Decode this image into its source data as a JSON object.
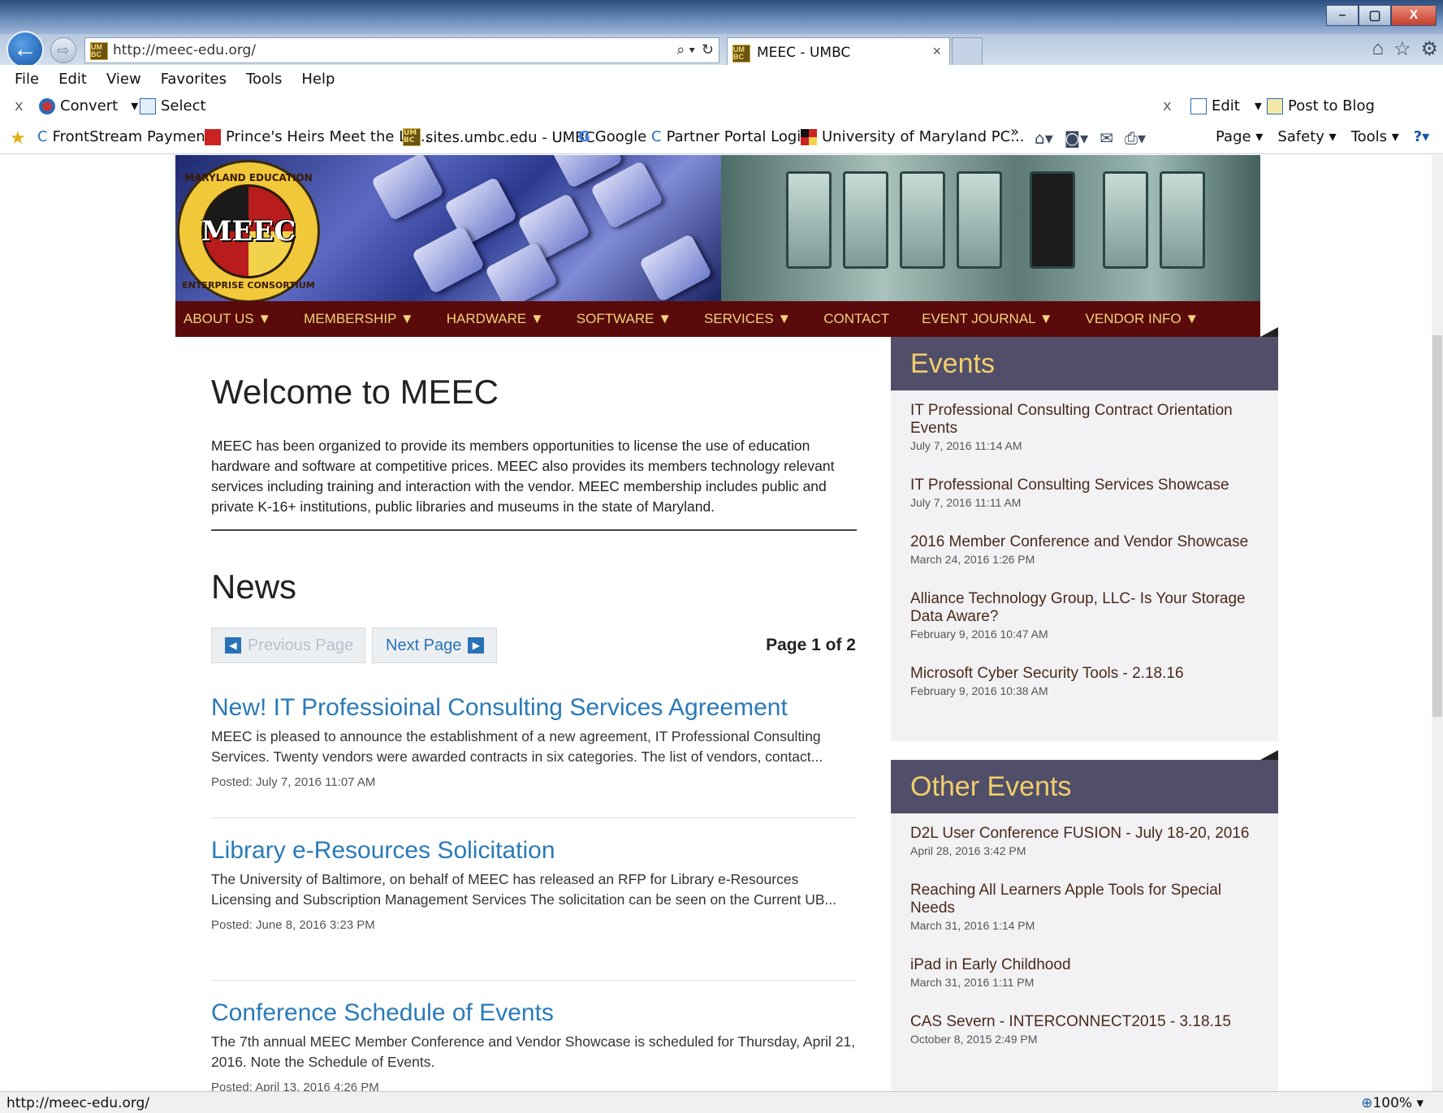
{
  "window": {
    "min": "–",
    "max": "▢",
    "close": "X"
  },
  "nav": {
    "address": "http://meec-edu.org/",
    "address_tools": [
      "⌕ ▾",
      "↻"
    ],
    "tab_title": "MEEC - UMBC",
    "tab_close": "×",
    "right_icons": [
      "⌂",
      "☆",
      "⚙"
    ]
  },
  "favicon": "UM BC",
  "menubar": [
    "File",
    "Edit",
    "View",
    "Favorites",
    "Tools",
    "Help"
  ],
  "cmdbar": {
    "close": "x",
    "convert": "Convert",
    "select": "Select",
    "close2": "x",
    "edit": "Edit",
    "post_to_blog": "Post to Blog",
    "dropdown": "▾"
  },
  "favbar": {
    "items": [
      "FrontStream Payments",
      "Prince's Heirs Meet the La...",
      "sites.umbc.edu - UMBC",
      "Google",
      "Partner Portal Login",
      "University of Maryland PC..."
    ],
    "more": "»",
    "tools": [
      "Page ▾",
      "Safety ▾",
      "Tools ▾"
    ]
  },
  "site": {
    "logo_text": "MEEC",
    "logo_ring_top": "MARYLAND EDUCATION",
    "logo_ring_bottom": "ENTERPRISE CONSORTIUM",
    "nav": [
      "ABOUT US ▼",
      "MEMBERSHIP ▼",
      "HARDWARE ▼",
      "SOFTWARE ▼",
      "SERVICES ▼",
      "CONTACT",
      "EVENT JOURNAL ▼",
      "VENDOR INFO ▼"
    ],
    "welcome": "Welcome to MEEC",
    "intro": "MEEC has been organized to provide its members opportunities to license the use of education hardware and software at competitive prices. MEEC also provides its members technology relevant services including training and interaction with the vendor. MEEC membership includes public and private K-16+ institutions, public libraries and museums in the state of Maryland.",
    "news_title": "News",
    "prev": "Previous Page",
    "next": "Next Page",
    "page_info": "Page 1 of 2",
    "news": [
      {
        "title": "New! IT Professioinal Consulting Services Agreement",
        "body": "MEEC is pleased to announce the establishment of a new agreement, IT Professional Consulting Services.  Twenty vendors were awarded contracts in six categories.  The list of vendors, contact...",
        "date": "Posted: July 7, 2016 11:07 AM"
      },
      {
        "title": "Library e-Resources Solicitation",
        "body": "The University of Baltimore, on behalf of MEEC has released an RFP for Library e-Resources Licensing and Subscription Management Services The solicitation can be seen on the Current UB...",
        "date": "Posted: June 8, 2016 3:23 PM"
      },
      {
        "title": "Conference Schedule of Events",
        "body": "The 7th annual MEEC Member Conference and Vendor Showcase is scheduled for Thursday, April 21, 2016.  Note the Schedule of Events.",
        "date": "Posted: April 13, 2016 4:26 PM"
      }
    ],
    "events_title": "Events",
    "events": [
      {
        "title": "IT Professional Consulting Contract Orientation Events",
        "date": "July 7, 2016 11:14 AM"
      },
      {
        "title": "IT Professional Consulting Services Showcase",
        "date": "July 7, 2016 11:11 AM"
      },
      {
        "title": "2016 Member Conference and Vendor Showcase",
        "date": "March 24, 2016 1:26 PM"
      },
      {
        "title": "Alliance Technology Group, LLC- Is Your Storage Data Aware?",
        "date": "February 9, 2016 10:47 AM"
      },
      {
        "title": "Microsoft Cyber Security Tools - 2.18.16",
        "date": "February 9, 2016 10:38 AM"
      }
    ],
    "other_title": "Other Events",
    "other_events": [
      {
        "title": "D2L User Conference FUSION - July 18-20, 2016",
        "date": "April 28, 2016 3:42 PM"
      },
      {
        "title": "Reaching All Learners Apple Tools for Special Needs",
        "date": "March 31, 2016 1:14 PM"
      },
      {
        "title": "iPad in Early Childhood",
        "date": "March 31, 2016 1:11 PM"
      },
      {
        "title": "CAS Severn - INTERCONNECT2015 - 3.18.15",
        "date": "October 8, 2015 2:49 PM"
      }
    ]
  },
  "status": {
    "url": "http://meec-edu.org/",
    "zoom": "100%"
  }
}
